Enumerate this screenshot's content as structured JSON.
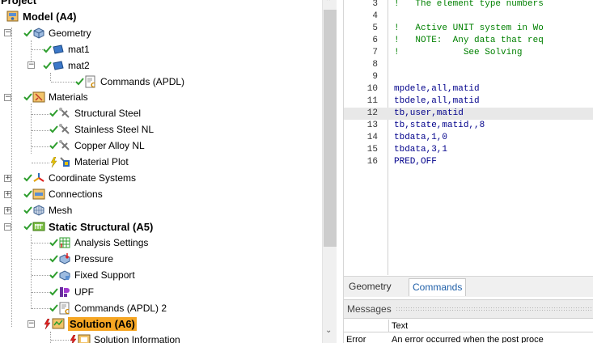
{
  "tree": {
    "title": "Project",
    "model": "Model (A4)",
    "geometry": "Geometry",
    "mat1": "mat1",
    "mat2": "mat2",
    "commands_apdl": "Commands (APDL)",
    "materials": "Materials",
    "structural_steel": "Structural Steel",
    "stainless_steel_nl": "Stainless Steel NL",
    "copper_alloy_nl": "Copper Alloy NL",
    "material_plot": "Material Plot",
    "coordinate_systems": "Coordinate Systems",
    "connections": "Connections",
    "mesh": "Mesh",
    "static_structural": "Static Structural (A5)",
    "analysis_settings": "Analysis Settings",
    "pressure": "Pressure",
    "fixed_support": "Fixed Support",
    "upf": "UPF",
    "commands_apdl_2": "Commands (APDL) 2",
    "solution": "Solution (A6)",
    "solution_information": "Solution Information"
  },
  "editor": {
    "lines": [
      {
        "num": "3",
        "text": "!   The element type numbers",
        "kind": "comment"
      },
      {
        "num": "4",
        "text": "",
        "kind": "plain"
      },
      {
        "num": "5",
        "text": "!   Active UNIT system in Wo",
        "kind": "comment"
      },
      {
        "num": "6",
        "text": "!   NOTE:  Any data that req",
        "kind": "comment"
      },
      {
        "num": "7",
        "text": "!            See Solving",
        "kind": "comment"
      },
      {
        "num": "8",
        "text": "",
        "kind": "plain"
      },
      {
        "num": "9",
        "text": "",
        "kind": "plain"
      },
      {
        "num": "10",
        "text": "mpdele,all,matid",
        "kind": "kw"
      },
      {
        "num": "11",
        "text": "tbdele,all,matid",
        "kind": "kw"
      },
      {
        "num": "12",
        "text": "tb,user,matid",
        "kind": "kw"
      },
      {
        "num": "13",
        "text": "tb,state,matid,,8",
        "kind": "kw"
      },
      {
        "num": "14",
        "text": "tbdata,1,0",
        "kind": "kw"
      },
      {
        "num": "15",
        "text": "tbdata,3,1",
        "kind": "kw"
      },
      {
        "num": "16",
        "text": "PRED,OFF",
        "kind": "kw"
      }
    ],
    "current_line": "12"
  },
  "tabs": {
    "geometry": "Geometry",
    "commands": "Commands"
  },
  "messages": {
    "title": "Messages",
    "col_text": "Text",
    "row_type": "Error",
    "row_text": "An error occurred when the post proce"
  },
  "colors": {
    "check_green": "#2e9e2e",
    "lightning_red": "#e02020",
    "selection_orange": "#f6a623",
    "code_blue": "#00008b",
    "comment_green": "#008000"
  }
}
